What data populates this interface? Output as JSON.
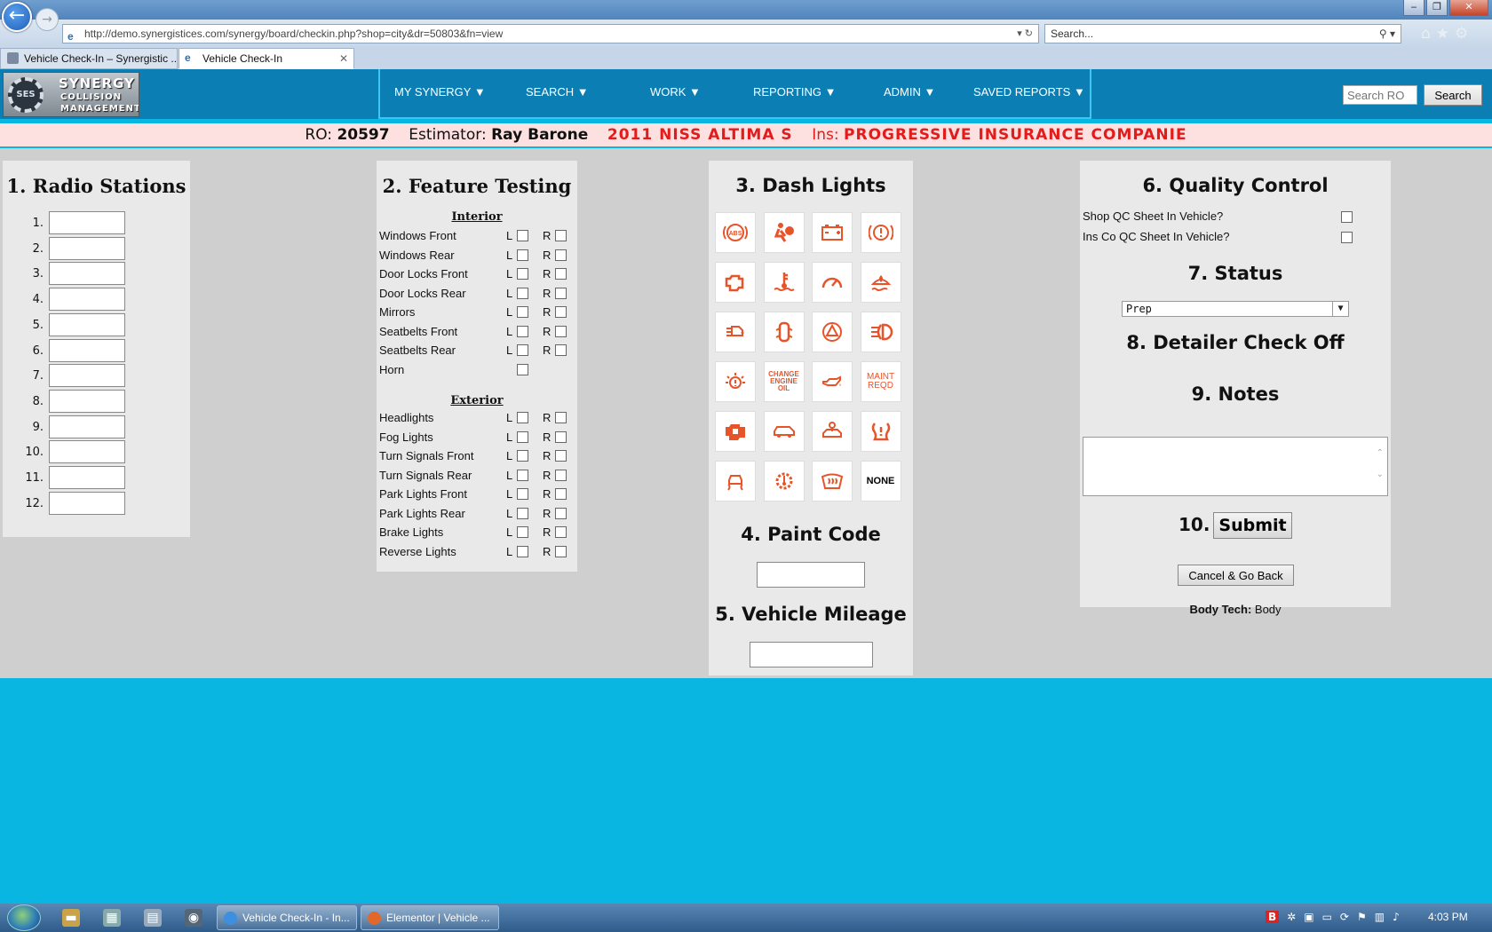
{
  "browser": {
    "url": "http://demo.synergistices.com/synergy/board/checkin.php?shop=city&dr=50803&fn=view",
    "search_placeholder": "Search...",
    "tabs": [
      {
        "label": "Vehicle Check-In – Synergistic ..."
      },
      {
        "label": "Vehicle Check-In"
      }
    ]
  },
  "app": {
    "logo": {
      "line1": "SYNERGY",
      "line2": "COLLISION",
      "line3": "MANAGEMENT",
      "badge": "SES"
    },
    "menu": [
      {
        "label": "MY SYNERGY ▼"
      },
      {
        "label": "SEARCH ▼"
      },
      {
        "label": "WORK ▼"
      },
      {
        "label": "REPORTING ▼"
      },
      {
        "label": "ADMIN ▼"
      },
      {
        "label": "SAVED REPORTS ▼"
      }
    ],
    "search_ro_placeholder": "Search RO",
    "search_button": "Search"
  },
  "ro_bar": {
    "ro_label": "RO:",
    "ro_number": "20597",
    "estimator_label": "Estimator:",
    "estimator": "Ray Barone",
    "vehicle": "2011 NISS ALTIMA S",
    "ins_label": "Ins:",
    "insurance": "PROGRESSIVE INSURANCE COMPANIE"
  },
  "radio": {
    "title": "1. Radio Stations",
    "rows": [
      "1.",
      "2.",
      "3.",
      "4.",
      "5.",
      "6.",
      "7.",
      "8.",
      "9.",
      "10.",
      "11.",
      "12."
    ]
  },
  "features": {
    "title": "2. Feature Testing",
    "interior_label": "Interior",
    "exterior_label": "Exterior",
    "left_label": "L",
    "right_label": "R",
    "interior": [
      "Windows Front",
      "Windows Rear",
      "Door Locks Front",
      "Door Locks Rear",
      "Mirrors",
      "Seatbelts Front",
      "Seatbelts Rear",
      "Horn"
    ],
    "exterior": [
      "Headlights",
      "Fog Lights",
      "Turn Signals Front",
      "Turn Signals Rear",
      "Park Lights Front",
      "Park Lights Rear",
      "Brake Lights",
      "Reverse Lights"
    ]
  },
  "dash": {
    "title": "3. Dash Lights",
    "icons": [
      "abs-icon",
      "airbag-icon",
      "battery-icon",
      "brake-warning-icon",
      "check-engine-icon",
      "coolant-temp-icon",
      "speedometer-icon",
      "washer-fluid-icon",
      "exhaust-icon",
      "door-ajar-icon",
      "master-warning-icon",
      "fog-light-icon",
      "bulb-warning-icon",
      "change-oil-icon",
      "oil-pressure-icon",
      "maint-reqd-icon",
      "engine-immobilizer-icon",
      "car-outline-icon",
      "security-car-icon",
      "tire-pressure-icon",
      "traction-control-icon",
      "transmission-temp-icon",
      "windshield-defrost-icon",
      "none-icon"
    ],
    "change_oil_text": [
      "CHANGE",
      "ENGINE",
      "OIL"
    ],
    "maint_text": [
      "MAINT",
      "REQD"
    ],
    "none_text": "NONE",
    "icon_color": "#e8542a"
  },
  "paint": {
    "title": "4. Paint Code"
  },
  "mileage": {
    "title": "5. Vehicle Mileage"
  },
  "qc": {
    "title": "6. Quality Control",
    "shop_label": "Shop QC Sheet In Vehicle?",
    "ins_label": "Ins Co QC Sheet In Vehicle?"
  },
  "status": {
    "title": "7. Status",
    "selected": "Prep"
  },
  "detailer": {
    "title": "8. Detailer Check Off"
  },
  "notes": {
    "title": "9. Notes"
  },
  "submit": {
    "number": "10.",
    "label": "Submit"
  },
  "cancel_label": "Cancel & Go Back",
  "body_tech": {
    "label": "Body Tech:",
    "value": "Body"
  },
  "taskbar": {
    "tasks": [
      {
        "label": "Vehicle Check-In - In..."
      },
      {
        "label": "Elementor | Vehicle ..."
      }
    ],
    "clock": "4:03 PM"
  },
  "colors": {
    "header_blue": "#0b7fb4",
    "page_blue": "#09b5e1",
    "ro_red": "#e21b1b",
    "ro_bg": "#fde0e0"
  }
}
